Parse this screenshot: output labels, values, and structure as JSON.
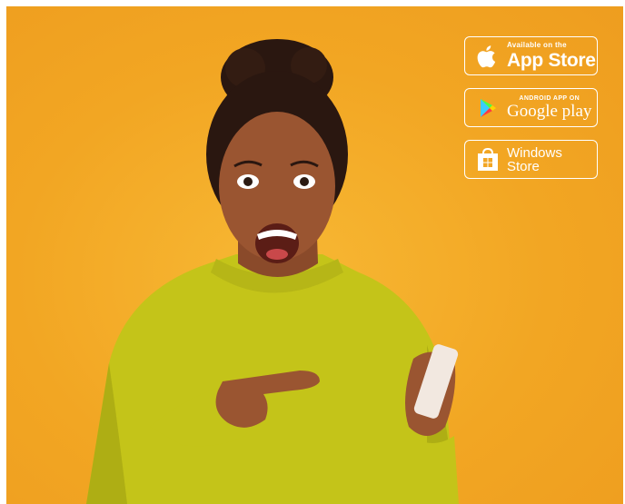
{
  "badges": {
    "appstore": {
      "small": "Available on the",
      "big": "App Store"
    },
    "googleplay": {
      "small": "ANDROID APP ON",
      "big": "Google play"
    },
    "windows": {
      "line1": "Windows",
      "line2": "Store"
    }
  },
  "colors": {
    "background": "#f2a623",
    "sweater": "#c4c419",
    "badge_stroke": "#ffffff"
  }
}
